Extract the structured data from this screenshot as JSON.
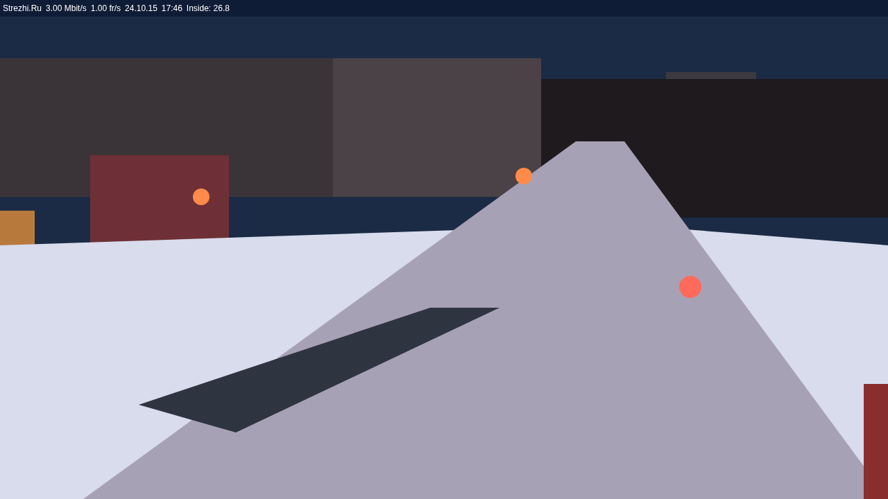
{
  "overlay": {
    "items": [
      {
        "text": "Strezhi.Ru"
      },
      {
        "text": "3.00 Mbit/s"
      },
      {
        "text": "1.00 fr/s"
      },
      {
        "text": "24.10.15"
      },
      {
        "text": "17:46"
      },
      {
        "text": "Inside: 26.8"
      }
    ]
  }
}
